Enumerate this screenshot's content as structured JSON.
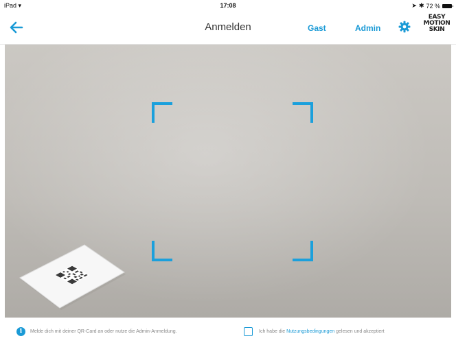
{
  "status_bar": {
    "device": "iPad",
    "time": "17:08",
    "battery": "72 %"
  },
  "nav": {
    "title": "Anmelden",
    "guest_label": "Gast",
    "admin_label": "Admin",
    "logo_lines": [
      "EASY",
      "MOTION",
      "SKIN"
    ]
  },
  "footer": {
    "info_text": "Melde dich mit deiner QR-Card an oder nutze die Admin-Anmeldung.",
    "terms_prefix": "Ich habe die",
    "terms_link": "Nutzungsbedingungen",
    "terms_suffix": "gelesen und akzeptiert"
  },
  "colors": {
    "accent": "#1a9ad6",
    "scan_frame": "#1ba0dc"
  },
  "icons": {
    "back": "arrow-left-icon",
    "settings": "gear-icon",
    "info": "info-icon"
  }
}
